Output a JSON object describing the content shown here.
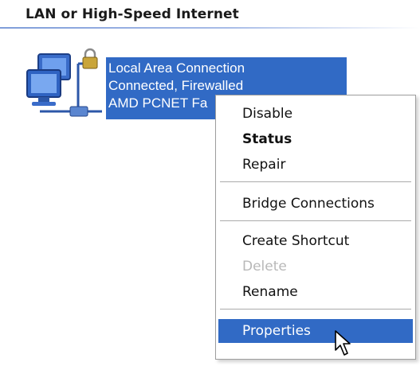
{
  "section": {
    "title": "LAN or High-Speed Internet"
  },
  "connection": {
    "icon": "network-connection-icon",
    "name": "Local Area Connection",
    "status": "Connected, Firewalled",
    "device": "AMD PCNET Fa"
  },
  "context_menu": {
    "items": [
      {
        "label": "Disable",
        "state": "normal"
      },
      {
        "label": "Status",
        "state": "default"
      },
      {
        "label": "Repair",
        "state": "normal"
      },
      {
        "label": "Bridge Connections",
        "state": "normal"
      },
      {
        "label": "Create Shortcut",
        "state": "normal"
      },
      {
        "label": "Delete",
        "state": "disabled"
      },
      {
        "label": "Rename",
        "state": "normal"
      },
      {
        "label": "Properties",
        "state": "selected"
      }
    ]
  },
  "colors": {
    "selection": "#316ac5",
    "selection_text": "#ffffff",
    "disabled_text": "#b8b8b8"
  },
  "cursor": "arrow-cursor-icon"
}
